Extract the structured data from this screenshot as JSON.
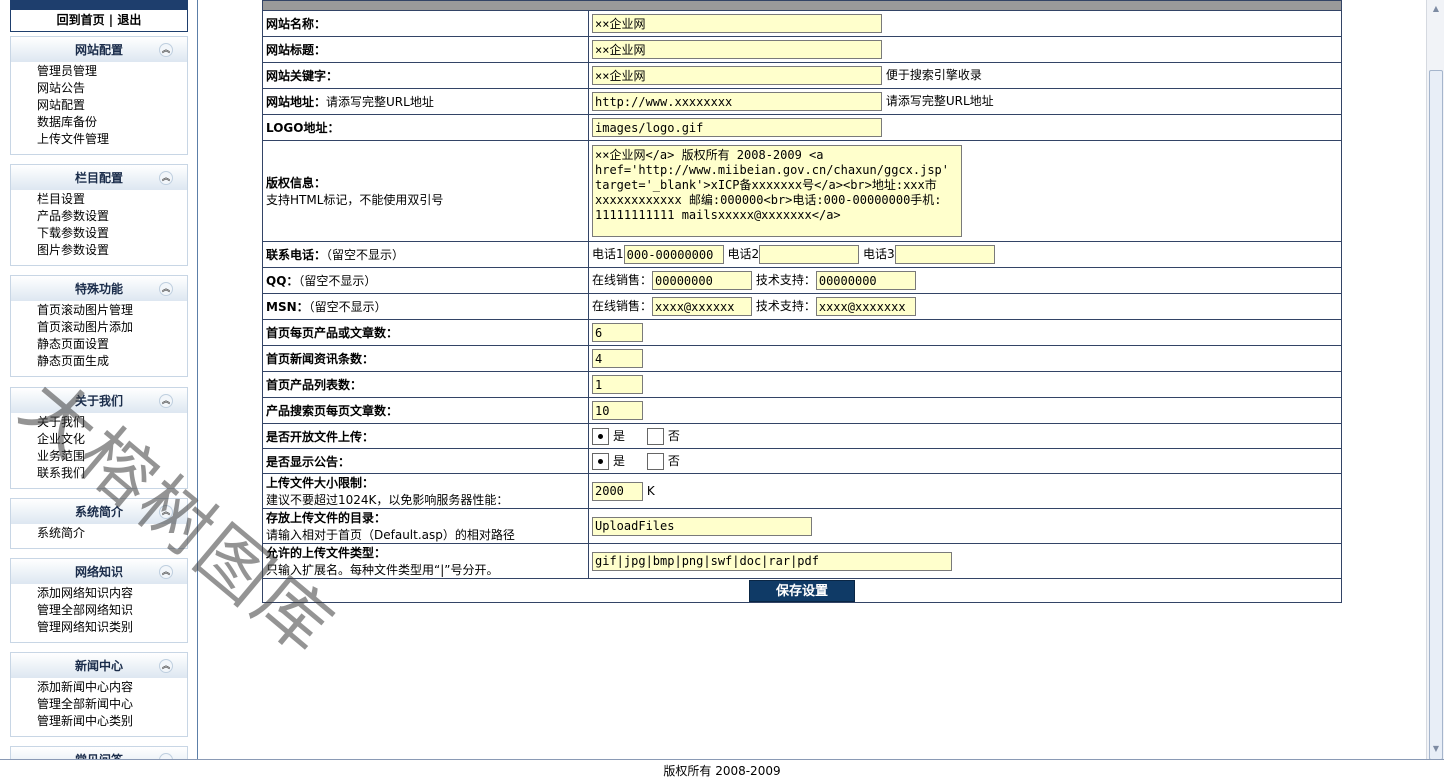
{
  "sidebar": {
    "top_links": {
      "home": "回到首页",
      "separator": "|",
      "logout": "退出"
    },
    "groups": [
      {
        "title": "网站配置",
        "items": [
          "管理员管理",
          "网站公告",
          "网站配置",
          "数据库备份",
          "上传文件管理"
        ]
      },
      {
        "title": "栏目配置",
        "items": [
          "栏目设置",
          "产品参数设置",
          "下载参数设置",
          "图片参数设置"
        ]
      },
      {
        "title": "特殊功能",
        "items": [
          "首页滚动图片管理",
          "首页滚动图片添加",
          "静态页面设置",
          "静态页面生成"
        ]
      },
      {
        "title": "关于我们",
        "items": [
          "关于我们",
          "企业文化",
          "业务范围",
          "联系我们"
        ]
      },
      {
        "title": "系统简介",
        "items": [
          "系统简介"
        ]
      },
      {
        "title": "网络知识",
        "items": [
          "添加网络知识内容",
          "管理全部网络知识",
          "管理网络知识类别"
        ]
      },
      {
        "title": "新闻中心",
        "items": [
          "添加新闻中心内容",
          "管理全部新闻中心",
          "管理新闻中心类别"
        ]
      },
      {
        "title": "常见问答",
        "items": []
      }
    ],
    "collapse_glyph": "︽"
  },
  "form": {
    "site_name": {
      "label": "网站名称：",
      "value": "××企业网"
    },
    "site_title": {
      "label": "网站标题：",
      "value": "××企业网"
    },
    "site_keywords": {
      "label": "网站关键字：",
      "value": "××企业网",
      "hint": "便于搜索引擎收录"
    },
    "site_url": {
      "label": "网站地址：",
      "label_note": "请添写完整URL地址",
      "value": "http://www.xxxxxxxx",
      "hint": "请添写完整URL地址"
    },
    "logo_url": {
      "label": "LOGO地址：",
      "value": "images/logo.gif"
    },
    "copyright": {
      "label": "版权信息：",
      "note": "支持HTML标记，不能使用双引号",
      "value": "××企业网</a> 版权所有 2008-2009 <a href='http://www.miibeian.gov.cn/chaxun/ggcx.jsp' target='_blank'>xICP备xxxxxxx号</a><br>地址:xxx市xxxxxxxxxxxx 邮编:000000<br>电话:000-00000000手机: 11111111111 mailsxxxxx@xxxxxxx</a>"
    },
    "phone": {
      "label": "联系电话：",
      "note": "（留空不显示）",
      "p1_label": "电话1",
      "p1_value": "000-00000000",
      "p2_label": "电话2",
      "p2_value": "",
      "p3_label": "电话3",
      "p3_value": ""
    },
    "qq": {
      "label": "QQ：",
      "note": "（留空不显示）",
      "sales_label": "在线销售：",
      "sales_value": "00000000",
      "support_label": "技术支持：",
      "support_value": "00000000"
    },
    "msn": {
      "label": "MSN：",
      "note": "（留空不显示）",
      "sales_label": "在线销售：",
      "sales_value": "xxxx@xxxxxx",
      "support_label": "技术支持：",
      "support_value": "xxxx@xxxxxxx"
    },
    "home_products_per_page": {
      "label": "首页每页产品或文章数：",
      "value": "6"
    },
    "home_news_count": {
      "label": "首页新闻资讯条数：",
      "value": "4"
    },
    "home_product_columns": {
      "label": "首页产品列表数：",
      "value": "1"
    },
    "search_per_page": {
      "label": "产品搜索页每页文章数：",
      "value": "10"
    },
    "allow_upload": {
      "label": "是否开放文件上传：",
      "yes": "是",
      "no": "否",
      "selected": "yes"
    },
    "show_notice": {
      "label": "是否显示公告：",
      "yes": "是",
      "no": "否",
      "selected": "yes"
    },
    "upload_size": {
      "label": "上传文件大小限制：",
      "note": "建议不要超过1024K，以免影响服务器性能：",
      "value": "2000",
      "unit": "K"
    },
    "upload_dir": {
      "label": "存放上传文件的目录：",
      "note": "请输入相对于首页（Default.asp）的相对路径",
      "value": "UploadFiles"
    },
    "allowed_types": {
      "label": "允许的上传文件类型：",
      "note": "只输入扩展名。每种文件类型用“|”号分开。",
      "value": "gif|jpg|bmp|png|swf|doc|rar|pdf"
    },
    "save_label": "保存设置"
  },
  "footer": {
    "text": "版权所有 2008-2009"
  },
  "watermark": {
    "text": "大榕树图库"
  },
  "colors": {
    "nav_dark": "#1e3e6d",
    "input_bg": "#ffffcc",
    "button_bg": "#0f3a66"
  }
}
